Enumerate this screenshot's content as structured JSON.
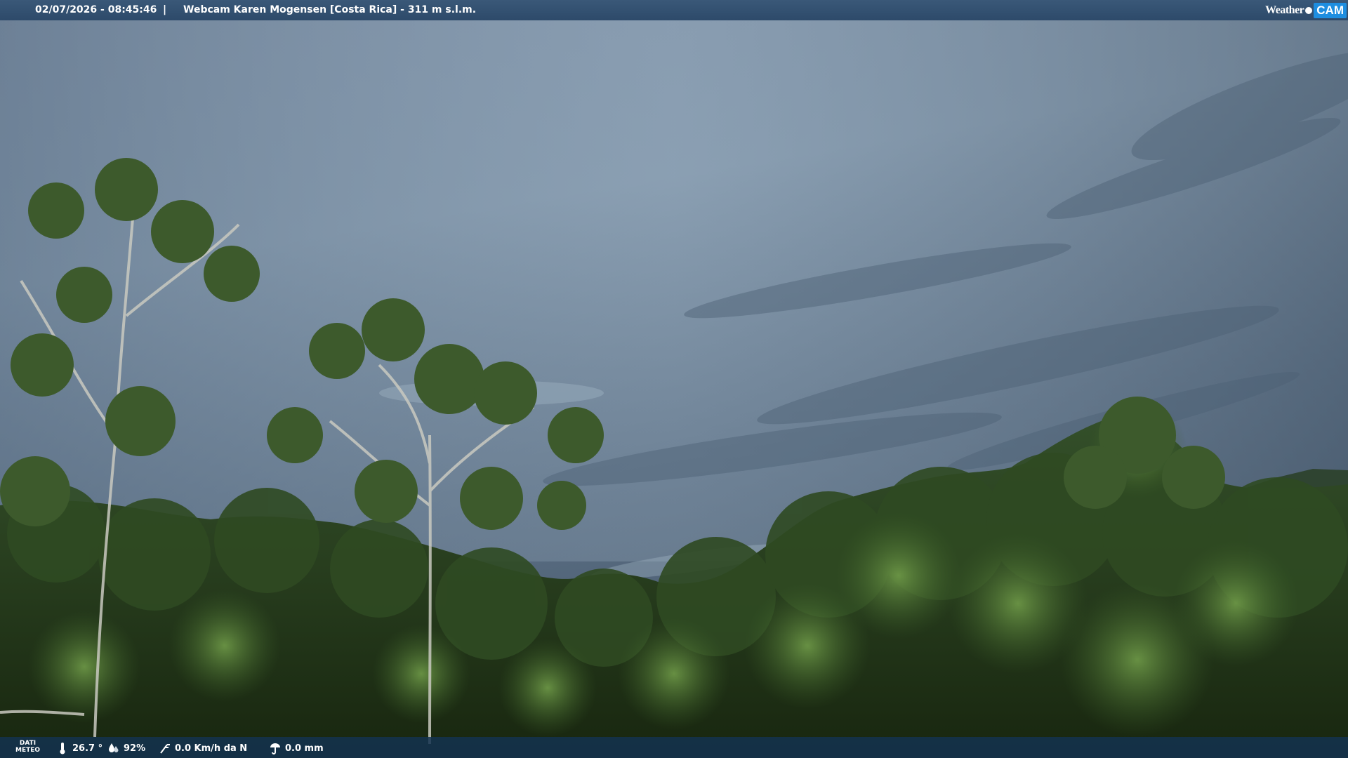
{
  "header": {
    "datetime": "02/07/2026 - 08:45:46",
    "separator": "|",
    "title": "Webcam Karen Mogensen [Costa Rica]  - 311 m s.l.m.",
    "logo": {
      "weather": "Weather",
      "cam": "CAM"
    }
  },
  "weather_bar": {
    "label_line1": "DATI",
    "label_line2": "METEO",
    "temperature": "26.7 °",
    "humidity": "92%",
    "wind": "0.0 Km/h da N",
    "rain": "0.0 mm",
    "icons": [
      "thermometer-icon",
      "humidity-icon",
      "wind-icon",
      "rain-icon"
    ]
  },
  "colors": {
    "sky_top": "#8497ad",
    "sky_bottom": "#4e6278",
    "forest_dark": "#1d2f1a",
    "forest_light": "#4f7a35",
    "brand_blue": "#1e8ee0"
  }
}
